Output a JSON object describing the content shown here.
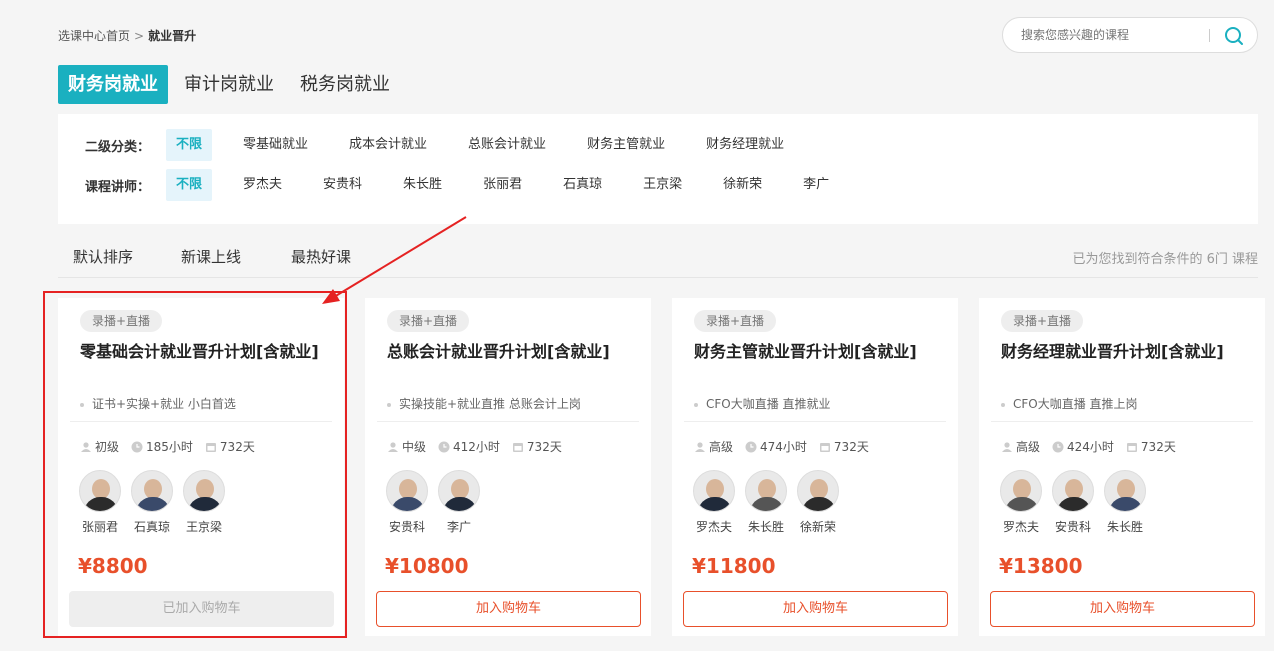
{
  "breadcrumb": {
    "home": "选课中心首页",
    "sep": ">",
    "current": "就业晋升"
  },
  "search": {
    "placeholder": "搜索您感兴趣的课程"
  },
  "tabs": [
    {
      "label": "财务岗就业",
      "active": true
    },
    {
      "label": "审计岗就业",
      "active": false
    },
    {
      "label": "税务岗就业",
      "active": false
    }
  ],
  "filters": {
    "category": {
      "label": "二级分类：",
      "options": [
        "不限",
        "零基础就业",
        "成本会计就业",
        "总账会计就业",
        "财务主管就业",
        "财务经理就业"
      ]
    },
    "teacher": {
      "label": "课程讲师：",
      "options": [
        "不限",
        "罗杰夫",
        "安贵科",
        "朱长胜",
        "张丽君",
        "石真琼",
        "王京梁",
        "徐新荣",
        "李广"
      ]
    }
  },
  "sort": {
    "options": [
      "默认排序",
      "新课上线",
      "最热好课"
    ],
    "found_text": "已为您找到符合条件的 6门 课程"
  },
  "colors": {
    "accent": "#1ab0c0",
    "price": "#e8502b",
    "highlight": "#e52222"
  },
  "courses": [
    {
      "badge": "录播+直播",
      "title": "零基础会计就业晋升计划[含就业]",
      "desc": "证书+实操+就业 小白首选",
      "level": "初级",
      "hours": "185小时",
      "days": "732天",
      "teachers": [
        "张丽君",
        "石真琼",
        "王京梁"
      ],
      "price": "¥8800",
      "cart": "已加入购物车"
    },
    {
      "badge": "录播+直播",
      "title": "总账会计就业晋升计划[含就业]",
      "desc": "实操技能+就业直推 总账会计上岗",
      "level": "中级",
      "hours": "412小时",
      "days": "732天",
      "teachers": [
        "安贵科",
        "李广"
      ],
      "price": "¥10800",
      "cart": "加入购物车"
    },
    {
      "badge": "录播+直播",
      "title": "财务主管就业晋升计划[含就业]",
      "desc": "CFO大咖直播 直推就业",
      "level": "高级",
      "hours": "474小时",
      "days": "732天",
      "teachers": [
        "罗杰夫",
        "朱长胜",
        "徐新荣"
      ],
      "price": "¥11800",
      "cart": "加入购物车"
    },
    {
      "badge": "录播+直播",
      "title": "财务经理就业晋升计划[含就业]",
      "desc": "CFO大咖直播 直推上岗",
      "level": "高级",
      "hours": "424小时",
      "days": "732天",
      "teachers": [
        "罗杰夫",
        "安贵科",
        "朱长胜"
      ],
      "price": "¥13800",
      "cart": "加入购物车"
    }
  ]
}
